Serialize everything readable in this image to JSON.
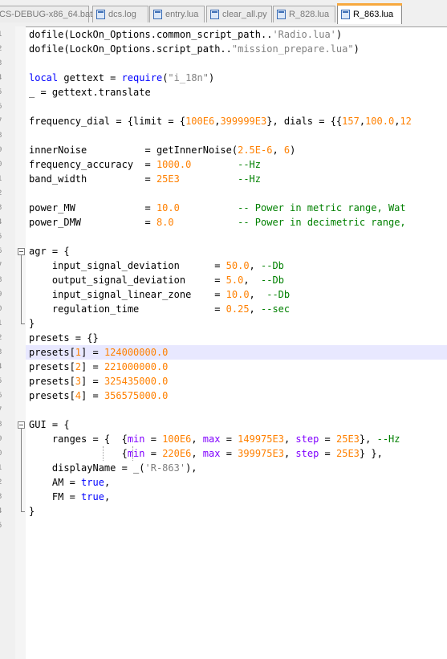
{
  "tabs": [
    {
      "label": "CS-DEBUG-x86_64.bat",
      "active": false
    },
    {
      "label": "dcs.log",
      "active": false
    },
    {
      "label": "entry.lua",
      "active": false
    },
    {
      "label": "clear_all.py",
      "active": false
    },
    {
      "label": "R_828.lua",
      "active": false
    },
    {
      "label": "R_863.lua",
      "active": true
    }
  ],
  "line_numbers": [
    "1",
    "2",
    "3",
    "4",
    "5",
    "6",
    "7",
    "8",
    "9",
    "0",
    "1",
    "2",
    "3",
    "4",
    "5",
    "6",
    "7",
    "8",
    "9",
    "0",
    "1",
    "2",
    "3",
    "4",
    "5",
    "6",
    "7",
    "8",
    "9",
    "0",
    "1",
    "2",
    "3",
    "4",
    "5"
  ],
  "code_lines": [
    [
      [
        "",
        "dofile(LockOn_Options.common_script_path.."
      ],
      [
        "s",
        "'Radio.lua'"
      ],
      [
        "",
        ")"
      ]
    ],
    [
      [
        "",
        "dofile(LockOn_Options.script_path.."
      ],
      [
        "s",
        "\"mission_prepare.lua\""
      ],
      [
        "",
        ")"
      ]
    ],
    [],
    [
      [
        "k",
        "local"
      ],
      [
        "",
        " gettext = "
      ],
      [
        "k",
        "require"
      ],
      [
        "",
        "("
      ],
      [
        "s",
        "\"i_18n\""
      ],
      [
        "",
        ")"
      ]
    ],
    [
      [
        "",
        "_ = gettext.translate"
      ]
    ],
    [],
    [
      [
        "",
        "frequency_dial = {limit = {"
      ],
      [
        "n",
        "100E6"
      ],
      [
        "",
        ","
      ],
      [
        "n",
        "399999E3"
      ],
      [
        "",
        "}, dials = {{"
      ],
      [
        "n",
        "157"
      ],
      [
        "",
        ","
      ],
      [
        "n",
        "100.0"
      ],
      [
        "",
        ","
      ],
      [
        "n",
        "12"
      ]
    ],
    [],
    [
      [
        "",
        "innerNoise          = getInnerNoise("
      ],
      [
        "n",
        "2.5E-6"
      ],
      [
        "",
        ", "
      ],
      [
        "n",
        "6"
      ],
      [
        "",
        ")"
      ]
    ],
    [
      [
        "",
        "frequency_accuracy  = "
      ],
      [
        "n",
        "1000.0"
      ],
      [
        "",
        "        "
      ],
      [
        "c",
        "--Hz"
      ]
    ],
    [
      [
        "",
        "band_width          = "
      ],
      [
        "n",
        "25E3"
      ],
      [
        "",
        "          "
      ],
      [
        "c",
        "--Hz"
      ]
    ],
    [],
    [
      [
        "",
        "power_MW            = "
      ],
      [
        "n",
        "10.0"
      ],
      [
        "",
        "          "
      ],
      [
        "c",
        "-- Power in metric range, Wat"
      ]
    ],
    [
      [
        "",
        "power_DMW           = "
      ],
      [
        "n",
        "8.0"
      ],
      [
        "",
        "           "
      ],
      [
        "c",
        "-- Power in decimetric range, "
      ]
    ],
    [],
    [
      [
        "",
        "agr = {"
      ]
    ],
    [
      [
        "",
        "    input_signal_deviation      = "
      ],
      [
        "n",
        "50.0"
      ],
      [
        "",
        ", "
      ],
      [
        "c",
        "--Db"
      ]
    ],
    [
      [
        "",
        "    output_signal_deviation     = "
      ],
      [
        "n",
        "5.0"
      ],
      [
        "",
        ",  "
      ],
      [
        "c",
        "--Db"
      ]
    ],
    [
      [
        "",
        "    input_signal_linear_zone    = "
      ],
      [
        "n",
        "10.0"
      ],
      [
        "",
        ",  "
      ],
      [
        "c",
        "--Db"
      ]
    ],
    [
      [
        "",
        "    regulation_time             = "
      ],
      [
        "n",
        "0.25"
      ],
      [
        "",
        ", "
      ],
      [
        "c",
        "--sec"
      ]
    ],
    [
      [
        "",
        "}"
      ]
    ],
    [
      [
        "",
        "presets = {}"
      ]
    ],
    [
      [
        "",
        "presets["
      ],
      [
        "n",
        "1"
      ],
      [
        "",
        "] = "
      ],
      [
        "n",
        "124000000.0"
      ]
    ],
    [
      [
        "",
        "presets["
      ],
      [
        "n",
        "2"
      ],
      [
        "",
        "] = "
      ],
      [
        "n",
        "221000000.0"
      ]
    ],
    [
      [
        "",
        "presets["
      ],
      [
        "n",
        "3"
      ],
      [
        "",
        "] = "
      ],
      [
        "n",
        "325435000.0"
      ]
    ],
    [
      [
        "",
        "presets["
      ],
      [
        "n",
        "4"
      ],
      [
        "",
        "] = "
      ],
      [
        "n",
        "356575000.0"
      ]
    ],
    [],
    [
      [
        "",
        "GUI = {"
      ]
    ],
    [
      [
        "",
        "    ranges = {  {"
      ],
      [
        "p",
        "min"
      ],
      [
        "",
        " = "
      ],
      [
        "n",
        "100E6"
      ],
      [
        "",
        ", "
      ],
      [
        "p",
        "max"
      ],
      [
        "",
        " = "
      ],
      [
        "n",
        "149975E3"
      ],
      [
        "",
        ", "
      ],
      [
        "p",
        "step"
      ],
      [
        "",
        " = "
      ],
      [
        "n",
        "25E3"
      ],
      [
        "",
        "}, "
      ],
      [
        "c",
        "--Hz"
      ]
    ],
    [
      [
        "",
        "                {"
      ],
      [
        "p",
        "min"
      ],
      [
        "",
        " = "
      ],
      [
        "n",
        "220E6"
      ],
      [
        "",
        ", "
      ],
      [
        "p",
        "max"
      ],
      [
        "",
        " = "
      ],
      [
        "n",
        "399975E3"
      ],
      [
        "",
        ", "
      ],
      [
        "p",
        "step"
      ],
      [
        "",
        " = "
      ],
      [
        "n",
        "25E3"
      ],
      [
        "",
        "} },"
      ]
    ],
    [
      [
        "",
        "    displayName = _("
      ],
      [
        "s",
        "'R-863'"
      ],
      [
        "",
        "),"
      ]
    ],
    [
      [
        "",
        "    AM = "
      ],
      [
        "k",
        "true"
      ],
      [
        "",
        ","
      ]
    ],
    [
      [
        "",
        "    FM = "
      ],
      [
        "k",
        "true"
      ],
      [
        "",
        ","
      ]
    ],
    [
      [
        "",
        "}"
      ]
    ],
    []
  ],
  "highlighted_line": 23
}
